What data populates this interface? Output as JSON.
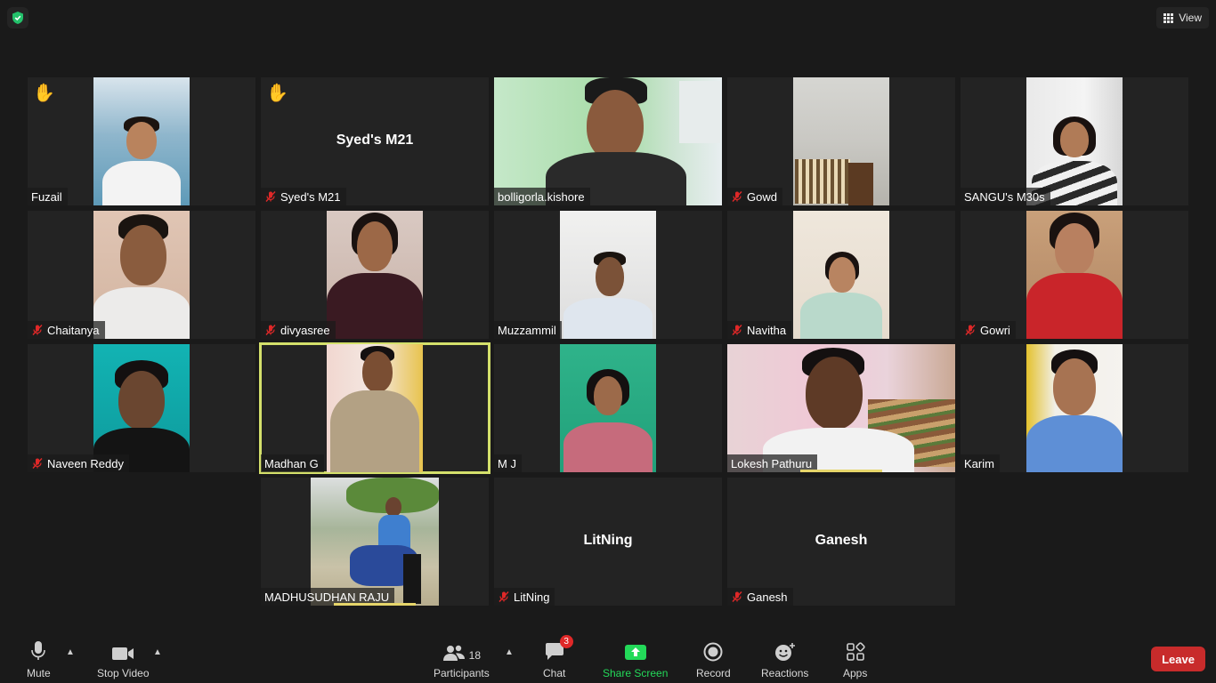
{
  "topbar": {
    "view_label": "View",
    "shield_icon": "shield-check-icon",
    "view_icon": "grid-icon"
  },
  "participants": [
    {
      "name": "Fuzail",
      "muted": false,
      "raised_hand": true,
      "video": true
    },
    {
      "name": "Syed's M21",
      "muted": true,
      "raised_hand": true,
      "video": false,
      "display_name": "Syed's M21"
    },
    {
      "name": "bolligorla.kishore",
      "muted": false,
      "raised_hand": false,
      "video": true
    },
    {
      "name": "Gowd",
      "muted": true,
      "raised_hand": false,
      "video": true
    },
    {
      "name": "SANGU's M30s",
      "muted": false,
      "raised_hand": false,
      "video": true
    },
    {
      "name": "Chaitanya",
      "muted": true,
      "raised_hand": false,
      "video": true
    },
    {
      "name": "divyasree",
      "muted": true,
      "raised_hand": false,
      "video": true
    },
    {
      "name": "Muzzammil",
      "muted": false,
      "raised_hand": false,
      "video": true
    },
    {
      "name": "Navitha",
      "muted": true,
      "raised_hand": false,
      "video": true
    },
    {
      "name": "Gowri",
      "muted": true,
      "raised_hand": false,
      "video": true
    },
    {
      "name": "Naveen Reddy",
      "muted": true,
      "raised_hand": false,
      "video": true
    },
    {
      "name": "Madhan G",
      "muted": false,
      "raised_hand": false,
      "video": true,
      "active_speaker": true
    },
    {
      "name": "M J",
      "muted": false,
      "raised_hand": false,
      "video": true
    },
    {
      "name": "Lokesh Pathuru",
      "muted": false,
      "raised_hand": false,
      "video": true
    },
    {
      "name": "Karim",
      "muted": false,
      "raised_hand": false,
      "video": true
    },
    {
      "name": "MADHUSUDHAN RAJU",
      "muted": false,
      "raised_hand": false,
      "video": true
    },
    {
      "name": "LitNing",
      "muted": true,
      "raised_hand": false,
      "video": false,
      "display_name": "LitNing"
    },
    {
      "name": "Ganesh",
      "muted": true,
      "raised_hand": false,
      "video": false,
      "display_name": "Ganesh"
    }
  ],
  "toolbar": {
    "mute_label": "Mute",
    "stop_video_label": "Stop Video",
    "participants_label": "Participants",
    "participants_count": "18",
    "chat_label": "Chat",
    "chat_badge": "3",
    "share_screen_label": "Share Screen",
    "record_label": "Record",
    "reactions_label": "Reactions",
    "apps_label": "Apps",
    "leave_label": "Leave",
    "share_color": "#23d959",
    "leave_color": "#c82b2b"
  },
  "colors": {
    "active_speaker_border": "#d4e06b",
    "muted_mic": "#e02828"
  }
}
